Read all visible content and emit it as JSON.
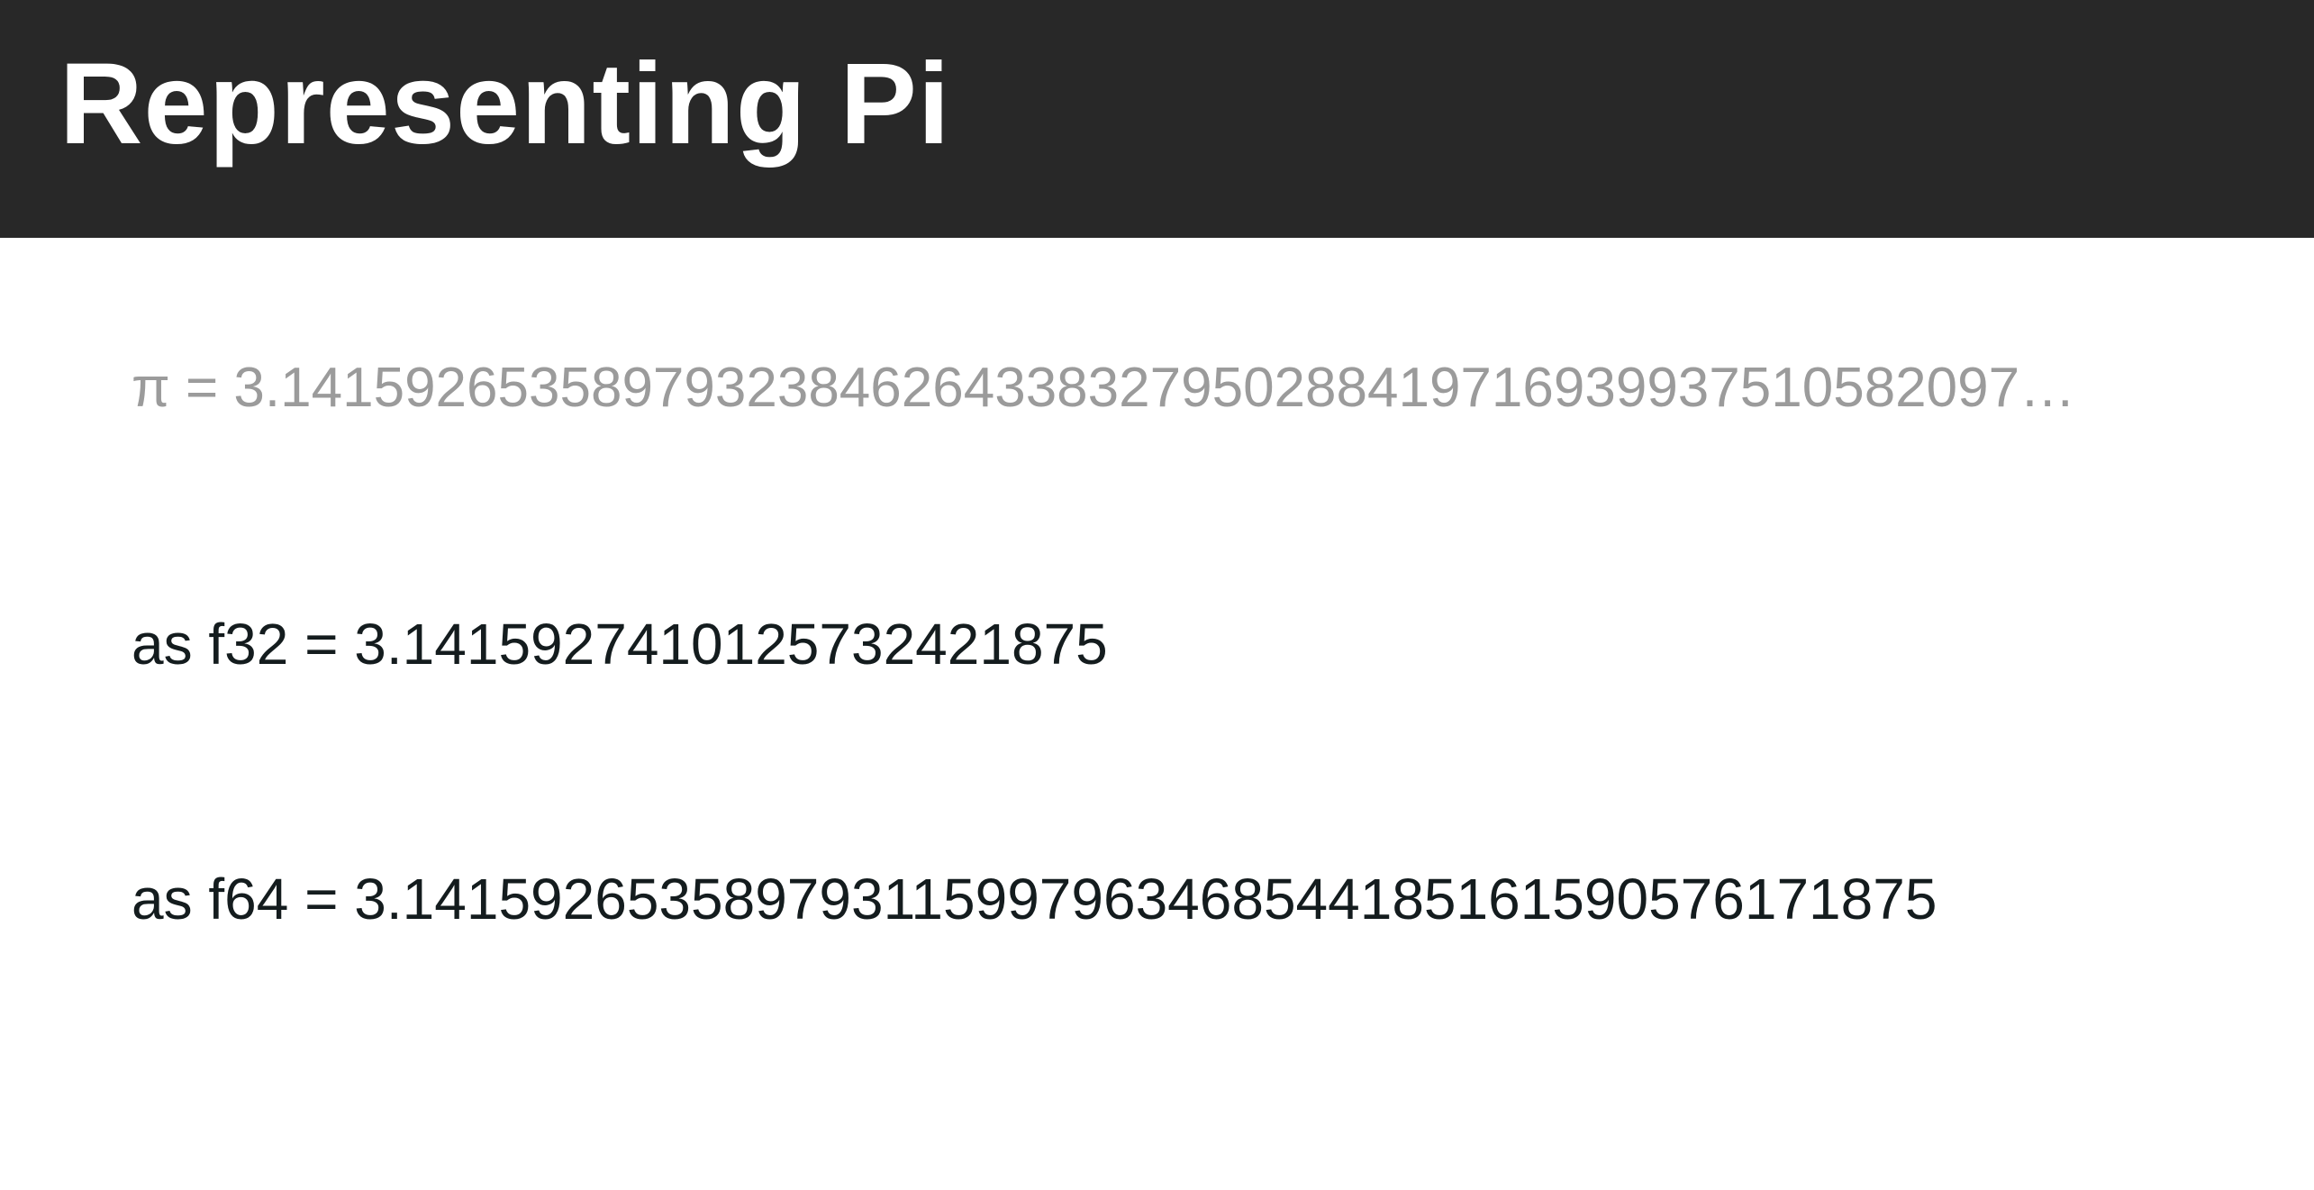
{
  "slide": {
    "title": "Representing Pi",
    "lines": {
      "pi": "π = 3.14159265358979323846264338327950288419716939937510582097…",
      "f32": "as f32 = 3.1415927410125732421875",
      "f64": "as f64 = 3.141592653589793115997963468544185161590576171875"
    }
  },
  "colors": {
    "header_background": "#282828",
    "title_text": "#ffffff",
    "background": "#ffffff",
    "pi_text": "#9b9b9b",
    "value_text": "#141c1e"
  }
}
